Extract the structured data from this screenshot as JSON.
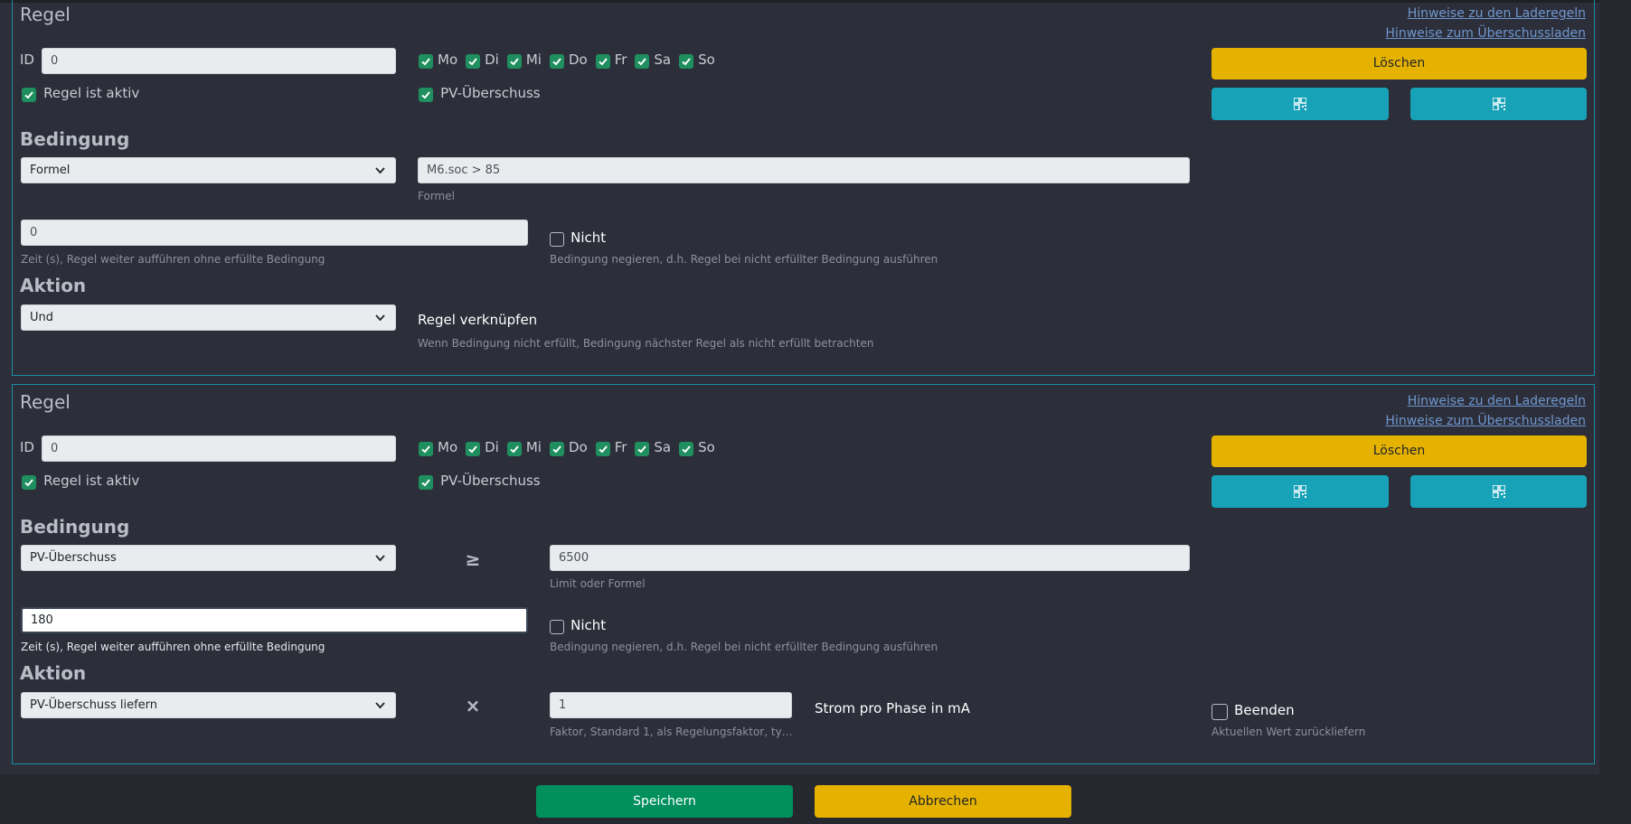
{
  "links": {
    "hints_charge_rules": "Hinweise zu den Laderegeln",
    "hints_surplus": "Hinweise zum Überschussladen"
  },
  "weekdays": [
    "Mo",
    "Di",
    "Mi",
    "Do",
    "Fr",
    "Sa",
    "So"
  ],
  "rule1": {
    "title": "Regel",
    "id_label": "ID",
    "id_value": "0",
    "active_label": "Regel ist aktiv",
    "pv_label": "PV-Überschuss",
    "delete_label": "Löschen",
    "condition_title": "Bedingung",
    "condition_type": "Formel",
    "formula_value": "M6.soc > 85",
    "formula_help": "Formel",
    "time_value": "0",
    "time_help": "Zeit (s), Regel weiter aufführen ohne erfüllte Bedingung",
    "not_label": "Nicht",
    "not_help": "Bedingung negieren, d.h. Regel bei nicht erfüllter Bedingung ausführen",
    "action_title": "Aktion",
    "action_type": "Und",
    "link_label": "Regel verknüpfen",
    "link_help": "Wenn Bedingung nicht erfüllt, Bedingung nächster Regel als nicht erfüllt betrachten"
  },
  "rule2": {
    "title": "Regel",
    "id_label": "ID",
    "id_value": "0",
    "active_label": "Regel ist aktiv",
    "pv_label": "PV-Überschuss",
    "delete_label": "Löschen",
    "condition_title": "Bedingung",
    "condition_type": "PV-Überschuss",
    "operator": "≥",
    "limit_value": "6500",
    "limit_help": "Limit oder Formel",
    "time_value": "180",
    "time_help": "Zeit (s), Regel weiter aufführen ohne erfüllte Bedingung",
    "not_label": "Nicht",
    "not_help": "Bedingung negieren, d.h. Regel bei nicht erfüllter Bedingung ausführen",
    "action_title": "Aktion",
    "action_type": "PV-Überschuss liefern",
    "multiply": "×",
    "factor_value": "1",
    "factor_help": "Faktor, Standard 1, als Regelungsfaktor, ty…",
    "current_label": "Strom pro Phase in mA",
    "end_label": "Beenden",
    "end_help": "Aktuellen Wert zurückliefern"
  },
  "footer": {
    "save_label": "Speichern",
    "cancel_label": "Abbrechen"
  },
  "colors": {
    "accent_green": "#008f5d",
    "warning_yellow": "#e6b200",
    "info_cyan": "#17a2b8",
    "panel_border": "#1b8fa3"
  }
}
